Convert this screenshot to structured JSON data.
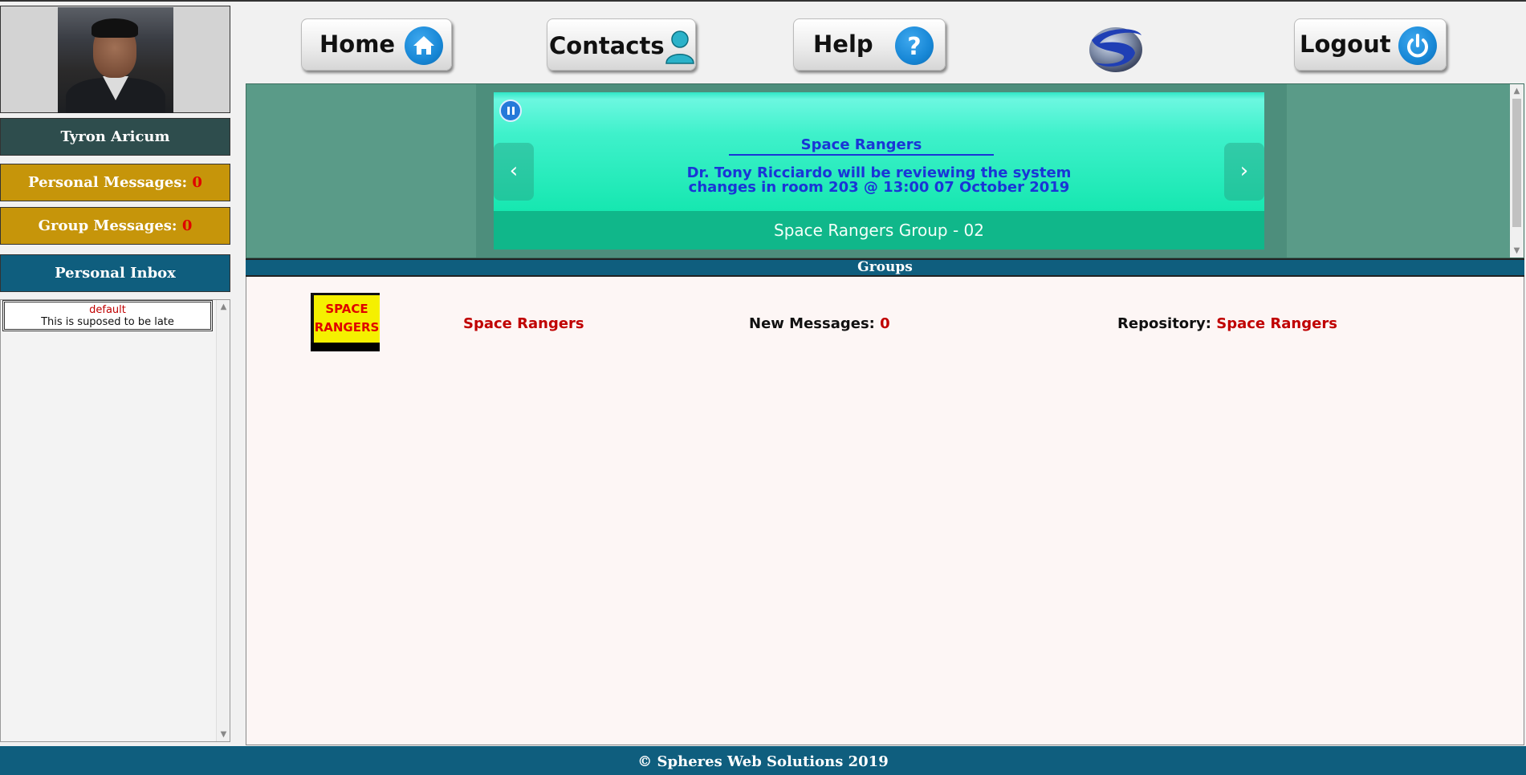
{
  "user": {
    "name": "Tyron Aricum",
    "personal_messages_label": "Personal Messages:",
    "personal_messages_count": "0",
    "group_messages_label": "Group Messages:",
    "group_messages_count": "0"
  },
  "inbox": {
    "title": "Personal Inbox",
    "items": [
      {
        "sender": "default",
        "subject": "This is suposed to be late"
      }
    ]
  },
  "nav": {
    "home": "Home",
    "contacts": "Contacts",
    "help": "Help",
    "logout": "Logout"
  },
  "carousel": {
    "title": "Space Rangers",
    "text_line1": "Dr. Tony Ricciardo will be reviewing the system",
    "text_line2": "changes in room 203 @ 13:00 07 October 2019",
    "caption": "Space Rangers Group - 02"
  },
  "groups": {
    "header": "Groups",
    "items": [
      {
        "logo_line1": "SPACE",
        "logo_line2": "RANGERS",
        "name": "Space Rangers",
        "new_label": "New Messages:",
        "new_count": "0",
        "repo_label": "Repository:",
        "repo_name": "Space Rangers"
      }
    ]
  },
  "footer": "© Spheres Web Solutions 2019",
  "colors": {
    "accent_teal": "#0f5e7e",
    "gold": "#c6950a",
    "alert_red": "#c00000",
    "banner_green": "#5a9b88"
  }
}
